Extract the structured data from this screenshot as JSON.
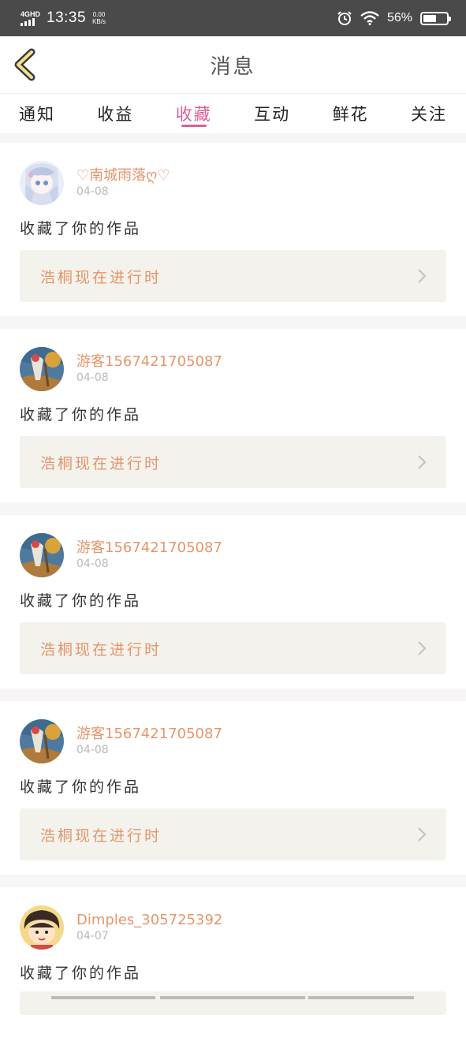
{
  "status_bar": {
    "network": "4GHD",
    "time": "13:35",
    "speed_value": "0.00",
    "speed_unit": "KB/s",
    "battery_percent": "56%",
    "battery_level": 0.56,
    "icons": [
      "signal-icon",
      "alarm-icon",
      "wifi-icon",
      "battery-icon"
    ]
  },
  "header": {
    "title": "消息",
    "back_icon": "chevron-left-icon"
  },
  "tabs": [
    {
      "label": "通知",
      "active": false
    },
    {
      "label": "收益",
      "active": false
    },
    {
      "label": "收藏",
      "active": true
    },
    {
      "label": "互动",
      "active": false
    },
    {
      "label": "鲜花",
      "active": false
    },
    {
      "label": "关注",
      "active": false
    }
  ],
  "colors": {
    "accent": "#d8609b",
    "username": "#e6956a",
    "card_bg": "#f3f2ec"
  },
  "items": [
    {
      "username": "♡南城雨落ღ♡",
      "date": "04-08",
      "message": "收藏了你的作品",
      "work_title": "浩桐现在进行时",
      "avatar": "anime-girl-avatar"
    },
    {
      "username": "游客1567421705087",
      "date": "04-08",
      "message": "收藏了你的作品",
      "work_title": "浩桐现在进行时",
      "avatar": "painting-avatar"
    },
    {
      "username": "游客1567421705087",
      "date": "04-08",
      "message": "收藏了你的作品",
      "work_title": "浩桐现在进行时",
      "avatar": "painting-avatar"
    },
    {
      "username": "游客1567421705087",
      "date": "04-08",
      "message": "收藏了你的作品",
      "work_title": "浩桐现在进行时",
      "avatar": "painting-avatar"
    },
    {
      "username": "Dimples_305725392",
      "date": "04-07",
      "message": "收藏了你的作品",
      "work_title": "",
      "avatar": "cartoon-girl-avatar"
    }
  ]
}
